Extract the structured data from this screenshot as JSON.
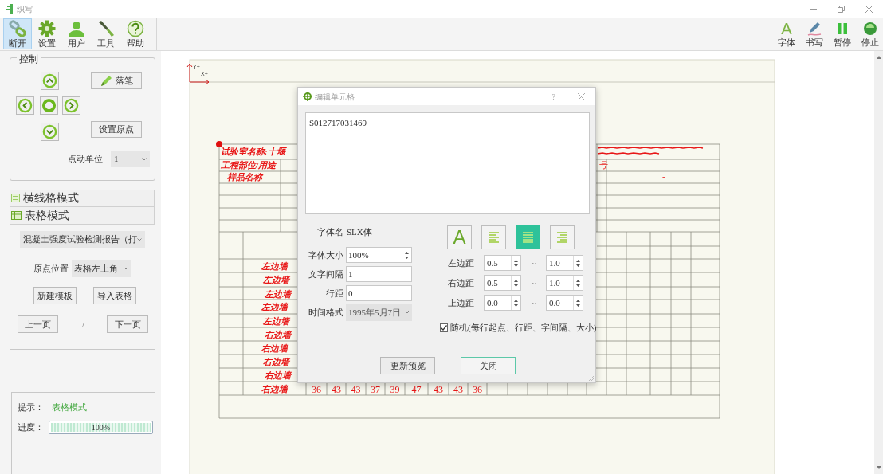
{
  "window": {
    "title": "织写"
  },
  "toolbar": {
    "left": [
      {
        "kind": "link",
        "label": "断开",
        "selected": true
      },
      {
        "kind": "gear",
        "label": "设置",
        "selected": false
      },
      {
        "kind": "user",
        "label": "用户",
        "selected": false
      },
      {
        "kind": "tool",
        "label": "工具",
        "selected": false
      },
      {
        "kind": "help",
        "label": "帮助",
        "selected": false
      }
    ],
    "right": [
      {
        "kind": "font",
        "glyph": "A",
        "label": "字体"
      },
      {
        "kind": "pen",
        "label": "书写"
      },
      {
        "kind": "pause",
        "label": "暂停"
      },
      {
        "kind": "stop",
        "label": "停止"
      }
    ]
  },
  "control_panel": {
    "title": "控制",
    "pen_button": "落笔",
    "set_origin_button": "设置原点",
    "jog_unit": {
      "label": "点动单位",
      "value": "1"
    }
  },
  "modes": [
    {
      "kind": "lines",
      "label": "横线格模式"
    },
    {
      "kind": "table",
      "label": "表格模式"
    }
  ],
  "template": {
    "value": "混凝土强度试验检测报告（打"
  },
  "origin": {
    "label": "原点位置",
    "value": "表格左上角"
  },
  "template_buttons": [
    "新建模板",
    "导入表格"
  ],
  "pager": {
    "prev": "上一页",
    "separator": "/",
    "next": "下一页"
  },
  "status": {
    "hint_label": "提示：",
    "hint": "表格模式",
    "progress_label": "进度：",
    "level": 1,
    "progress_text": "100%"
  },
  "sheet": {
    "axis": {
      "y": "Y+",
      "x": "X+"
    },
    "header_labels": [
      "试验室名称:十堰",
      "工程部位/用途",
      "样品名称"
    ],
    "right_labels": [
      "号",
      "-",
      "-"
    ],
    "row_labels": [
      "左边墙",
      "左边墙",
      "左边墙",
      "左边墙",
      "左边墙",
      "右边墙",
      "右边墙",
      "右边墙",
      "右边墙",
      "右边墙"
    ],
    "values": [
      "36",
      "43",
      "43",
      "37",
      "39",
      "47",
      "43",
      "43",
      "36"
    ]
  },
  "dialog": {
    "title": "编辑单元格",
    "help": "?",
    "text": "S012717031469",
    "fields": [
      {
        "kind": "static",
        "label": "字体名",
        "value": "SLX体"
      },
      {
        "kind": "spin",
        "label": "字体大小",
        "value": "100%"
      },
      {
        "kind": "text",
        "label": "文字间隔",
        "value": "1"
      },
      {
        "kind": "text",
        "label": "行距",
        "value": "0"
      },
      {
        "kind": "select",
        "label": "时间格式",
        "value": "1995年5月7日"
      }
    ],
    "style_buttons": [
      {
        "kind": "font",
        "glyph": "A",
        "selected": false
      },
      {
        "kind": "align-left",
        "selected": false
      },
      {
        "kind": "align-center",
        "selected": true
      },
      {
        "kind": "align-right",
        "selected": false
      }
    ],
    "margins": [
      {
        "label": "左边距",
        "min": "0.5",
        "separator": "~",
        "max": "1.0"
      },
      {
        "label": "右边距",
        "min": "0.5",
        "separator": "~",
        "max": "1.0"
      },
      {
        "label": "上边距",
        "min": "0.0",
        "separator": "~",
        "max": "0.0"
      }
    ],
    "random": {
      "label": "随机(每行起点、行距、字间隔、大小)",
      "checked": true
    },
    "buttons": [
      {
        "label": "更新预览",
        "default": false
      },
      {
        "label": "关闭",
        "default": true
      }
    ]
  }
}
